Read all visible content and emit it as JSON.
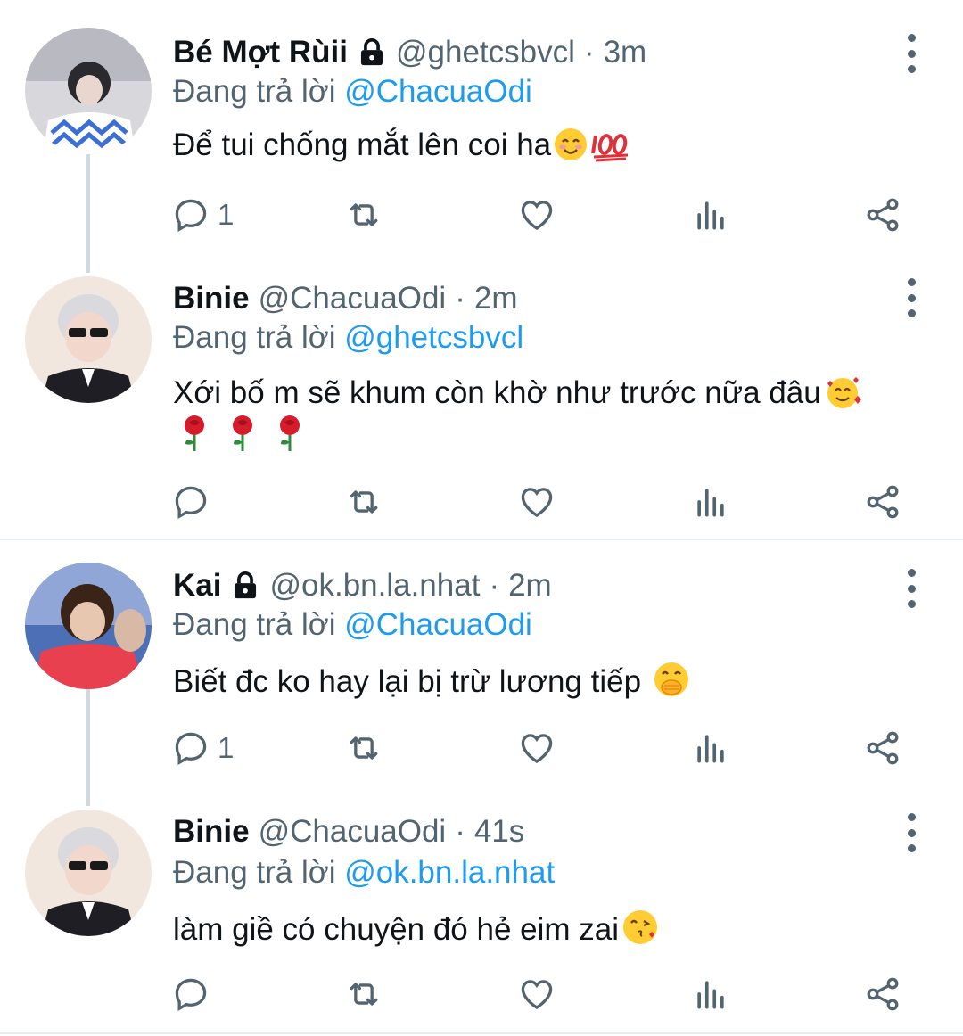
{
  "tweets": [
    {
      "name": "Bé Mợt Rùii",
      "locked": true,
      "handle": "@ghetcsbvcl",
      "separator": "·",
      "time": "3m",
      "replying_prefix": "Đang trả lời ",
      "replying_to": "@ChacuaOdi",
      "text": "Để tui chống mắt lên coi ha",
      "emojis": [
        "smiling-face-emoji",
        "hundred-points-emoji"
      ],
      "reply_count": "1"
    },
    {
      "name": "Binie",
      "locked": false,
      "handle": "@ChacuaOdi",
      "separator": "·",
      "time": "2m",
      "replying_prefix": "Đang trả lời ",
      "replying_to": "@ghetcsbvcl",
      "text": "Xới bố m sẽ khum còn khờ như trước nữa đâu",
      "emojis": [
        "smiling-face-with-hearts-emoji",
        "rose-emoji",
        "rose-emoji",
        "rose-emoji"
      ],
      "reply_count": ""
    },
    {
      "name": "Kai",
      "locked": true,
      "handle": "@ok.bn.la.nhat",
      "separator": "·",
      "time": "2m",
      "replying_prefix": "Đang trả lời ",
      "replying_to": "@ChacuaOdi",
      "text": "Biết đc ko hay lại bị trừ lương tiếp ",
      "emojis": [
        "face-with-hand-over-mouth-emoji"
      ],
      "reply_count": "1"
    },
    {
      "name": "Binie",
      "locked": false,
      "handle": "@ChacuaOdi",
      "separator": "·",
      "time": "41s",
      "replying_prefix": "Đang trả lời ",
      "replying_to": "@ok.bn.la.nhat",
      "text": "làm giề có chuyện đó hẻ eim zai",
      "emojis": [
        "face-blowing-kiss-emoji"
      ],
      "reply_count": ""
    }
  ],
  "colors": {
    "text": "#0f1419",
    "muted": "#536471",
    "link": "#1d9bf0",
    "thread_line": "#cfd9de",
    "divider": "#e6ecf0"
  },
  "icons": [
    "lock-icon",
    "more-icon",
    "reply-icon",
    "retweet-icon",
    "like-icon",
    "analytics-icon",
    "share-icon"
  ]
}
